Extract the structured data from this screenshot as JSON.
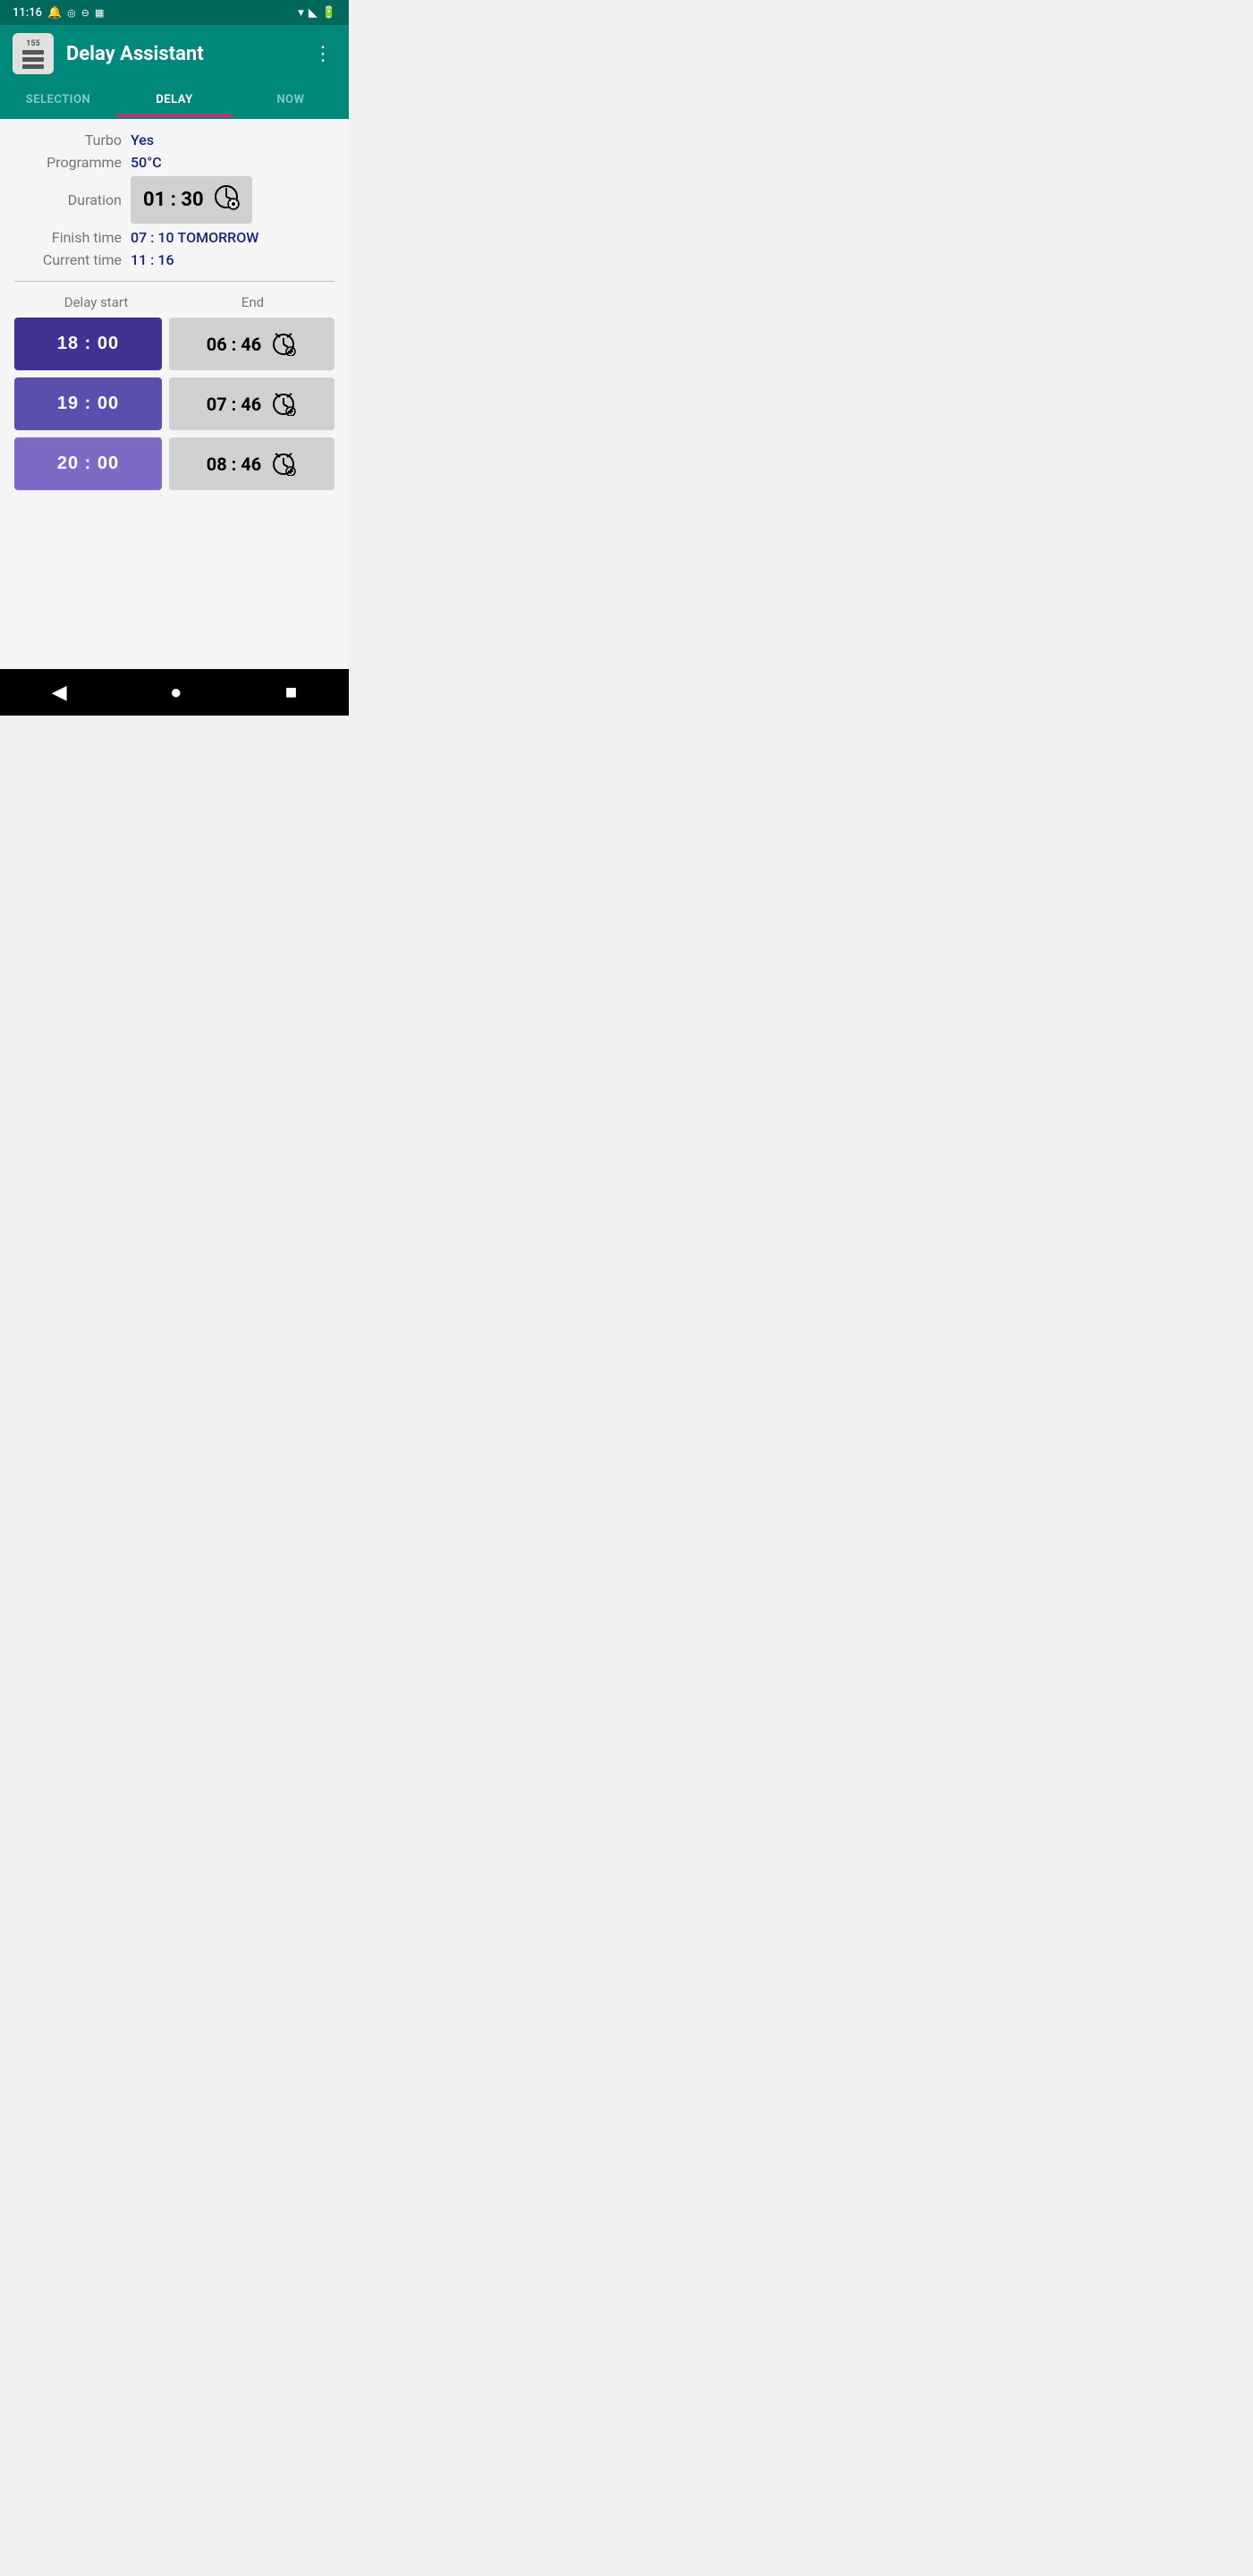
{
  "statusBar": {
    "time": "11:16",
    "icons": [
      "notification",
      "location",
      "dnd",
      "sd-card"
    ]
  },
  "appBar": {
    "title": "Delay Assistant",
    "appNumber": "155",
    "moreIcon": "⋮"
  },
  "tabs": [
    {
      "id": "selection",
      "label": "SELECTION",
      "active": false
    },
    {
      "id": "delay",
      "label": "DELAY",
      "active": true
    },
    {
      "id": "now",
      "label": "NOW",
      "active": false
    }
  ],
  "programInfo": {
    "turboLabel": "Turbo",
    "turboValue": "Yes",
    "programmeLabel": "Programme",
    "programmeValue": "50°C",
    "durationLabel": "Duration",
    "durationValue": "01 : 30",
    "finishTimeLabel": "Finish time",
    "finishTimeValue": "07 : 10",
    "finishTimeSuffix": "TOMORROW",
    "currentTimeLabel": "Current time",
    "currentTimeValue": "11 : 16"
  },
  "delayTable": {
    "col1Header": "Delay start",
    "col2Header": "End",
    "rows": [
      {
        "start": "18 : 00",
        "end": "06 : 46"
      },
      {
        "start": "19 : 00",
        "end": "07 : 46"
      },
      {
        "start": "20 : 00",
        "end": "08 : 46"
      }
    ]
  }
}
